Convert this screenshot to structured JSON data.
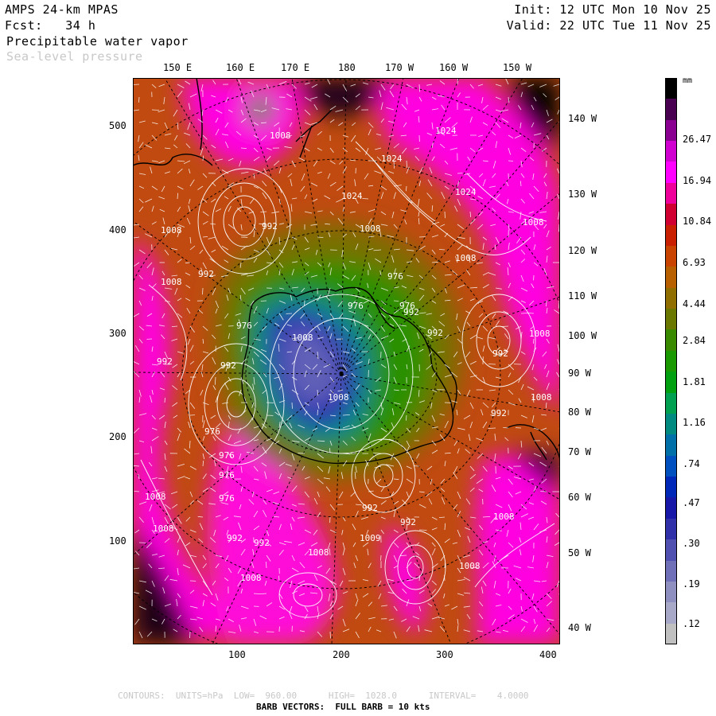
{
  "header": {
    "model": "AMPS 24-km MPAS",
    "forecast": "Fcst:   34 h",
    "field": "Precipitable water vapor",
    "overlay": "Sea-level pressure",
    "init": "Init: 12 UTC Mon 10 Nov 25",
    "valid": "Valid: 22 UTC Tue 11 Nov 25"
  },
  "axes": {
    "x_ticks": [
      "100",
      "200",
      "300",
      "400"
    ],
    "y_ticks": [
      "500",
      "400",
      "300",
      "200",
      "100"
    ],
    "top_lon_labels": [
      "150 E",
      "160 E",
      "170 E",
      "180",
      "170 W",
      "160 W",
      "150 W"
    ],
    "right_lon_labels": [
      "140 W",
      "130 W",
      "120 W",
      "110 W",
      "100 W",
      "90 W",
      "80 W",
      "70 W",
      "60 W",
      "50 W",
      "40 W"
    ]
  },
  "colorbar": {
    "unit": "mm",
    "labels": [
      "26.47",
      "16.94",
      "10.84",
      "6.93",
      "4.44",
      "2.84",
      "1.81",
      "1.16",
      ".74",
      ".47",
      ".30",
      ".19",
      ".12"
    ],
    "colors": [
      "#000000",
      "#4a0050",
      "#8a0090",
      "#d000d0",
      "#ff00ff",
      "#f0009a",
      "#d00030",
      "#c82000",
      "#c84400",
      "#b86000",
      "#906e00",
      "#6a7800",
      "#3a8a00",
      "#1a9a00",
      "#00a010",
      "#00a050",
      "#008a80",
      "#0070a8",
      "#0050c0",
      "#0028b8",
      "#1818a8",
      "#3030a8",
      "#5050b0",
      "#7070b8",
      "#9090c0",
      "#a8a8c8",
      "#c0c0c0"
    ]
  },
  "contour_labels": [
    "1024",
    "1024",
    "1024",
    "1024",
    "1008",
    "1008",
    "1008",
    "1008",
    "1008",
    "1008",
    "1008",
    "1008",
    "1008",
    "1008",
    "1008",
    "1008",
    "1008",
    "1008",
    "1008",
    "1009",
    "1008",
    "992",
    "992",
    "992",
    "992",
    "992",
    "992",
    "992",
    "992",
    "992",
    "992",
    "992",
    "992",
    "976",
    "976",
    "976",
    "976",
    "976",
    "976",
    "976",
    "976"
  ],
  "footer": {
    "contours": "CONTOURS:  UNITS=hPa  LOW=  960.00      HIGH=  1028.0      INTERVAL=    4.0000",
    "barbs": "BARB VECTORS:  FULL BARB = 10 kts"
  }
}
